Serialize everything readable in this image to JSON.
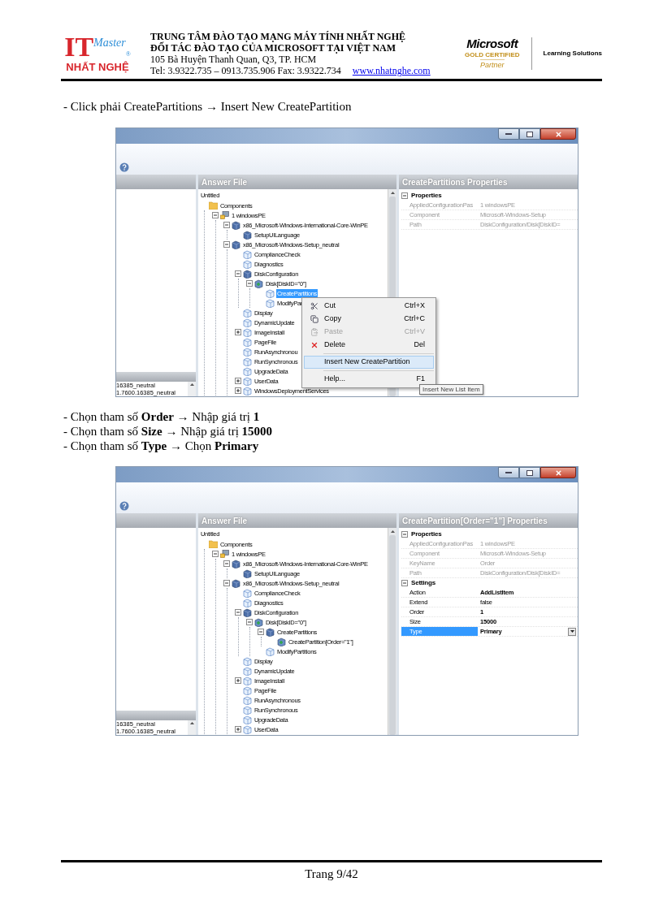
{
  "header": {
    "logo": {
      "mark": "IT",
      "script": "Master",
      "registered": "®",
      "name": "NHẤT NGHỆ"
    },
    "lines": [
      {
        "text": "TRUNG TÂM ĐÀO TẠO MẠNG MÁY TÍNH NHẤT NGHỆ",
        "emphasis": true
      },
      {
        "text": "ĐỐI TÁC ĐÀO TẠO CỦA MICROSOFT TẠI VIỆT NAM",
        "emphasis": true
      },
      {
        "text": "105 Bà Huyện Thanh Quan, Q3, TP. HCM",
        "emphasis": false
      },
      {
        "text": "Tel: 3.9322.735 – 0913.735.906 Fax: 3.9322.734",
        "emphasis": false
      }
    ],
    "website": "www.nhatnghe.com",
    "partner": {
      "brand": "Microsoft",
      "level": "GOLD CERTIFIED",
      "tier": "Partner",
      "tagline": "Learning Solutions"
    }
  },
  "sections": [
    {
      "instructions": [
        "- Click phải CreatePartitions → Insert New CreatePartition"
      ],
      "screenshot": {
        "left_pane": {
          "list": [
            "16385_neutral",
            "1.7600.16385_neutral"
          ]
        },
        "answer_file": {
          "title": "Answer File",
          "root_label": "Untitled",
          "tree": [
            {
              "label": "Components",
              "kind": "folder",
              "selected": false,
              "children": [
                {
                  "label": "1 windowsPE",
                  "kind": "pass",
                  "selected": false,
                  "expanded": true,
                  "children": [
                    {
                      "label": "x86_Microsoft-Windows-International-Core-WinPE",
                      "kind": "component",
                      "selected": false,
                      "expanded": true,
                      "children": [
                        {
                          "label": "SetupUILanguage",
                          "kind": "component",
                          "selected": false
                        }
                      ]
                    },
                    {
                      "label": "x86_Microsoft-Windows-Setup_neutral",
                      "kind": "component",
                      "selected": false,
                      "expanded": true,
                      "children": [
                        {
                          "label": "ComplianceCheck",
                          "kind": "setting",
                          "selected": false
                        },
                        {
                          "label": "Diagnostics",
                          "kind": "setting",
                          "selected": false
                        },
                        {
                          "label": "DiskConfiguration",
                          "kind": "component",
                          "selected": false,
                          "expanded": true,
                          "children": [
                            {
                              "label": "Disk[DiskID=\"0\"]",
                              "kind": "listitem",
                              "selected": false,
                              "expanded": true,
                              "children": [
                                {
                                  "label": "CreatePartitions",
                                  "kind": "setting",
                                  "selected": true
                                },
                                {
                                  "label": "ModifyPar",
                                  "kind": "setting",
                                  "selected": false
                                }
                              ]
                            }
                          ]
                        },
                        {
                          "label": "Display",
                          "kind": "setting",
                          "selected": false
                        },
                        {
                          "label": "DynamicUpdate",
                          "kind": "setting",
                          "selected": false
                        },
                        {
                          "label": "ImageInstall",
                          "kind": "setting",
                          "selected": false,
                          "expanded": false
                        },
                        {
                          "label": "PageFile",
                          "kind": "setting",
                          "selected": false
                        },
                        {
                          "label": "RunAsynchronou",
                          "kind": "setting",
                          "selected": false
                        },
                        {
                          "label": "RunSynchronous",
                          "kind": "setting",
                          "selected": false
                        },
                        {
                          "label": "UpgradeData",
                          "kind": "setting",
                          "selected": false
                        },
                        {
                          "label": "UserData",
                          "kind": "setting",
                          "selected": false,
                          "expanded": false
                        },
                        {
                          "label": "WindowsDeploymentServices",
                          "kind": "setting",
                          "selected": false,
                          "expanded": false
                        }
                      ]
                    }
                  ]
                }
              ]
            }
          ]
        },
        "properties": {
          "title": "CreatePartitions Properties",
          "sections": [
            {
              "label": "Properties",
              "expanded": true,
              "rows": [
                {
                  "name": "AppliedConfigurationPas",
                  "value": "1 windowsPE",
                  "readonly": true,
                  "modified": false,
                  "selected": false
                },
                {
                  "name": "Component",
                  "value": "Microsoft-Windows-Setup",
                  "readonly": true,
                  "modified": false,
                  "selected": false
                },
                {
                  "name": "Path",
                  "value": "DiskConfiguration/Disk[DiskID=",
                  "readonly": true,
                  "modified": false,
                  "selected": false
                }
              ]
            }
          ]
        },
        "context_menu": {
          "items": [
            {
              "kind": "item",
              "label": "Cut",
              "shortcut": "Ctrl+X",
              "disabled": false,
              "selected": false
            },
            {
              "kind": "item",
              "label": "Copy",
              "shortcut": "Ctrl+C",
              "disabled": false,
              "selected": false
            },
            {
              "kind": "item",
              "label": "Paste",
              "shortcut": "Ctrl+V",
              "disabled": true,
              "selected": false
            },
            {
              "kind": "item",
              "label": "Delete",
              "shortcut": "Del",
              "disabled": false,
              "selected": false
            },
            {
              "kind": "separator"
            },
            {
              "kind": "item",
              "label": "Insert New CreatePartition",
              "disabled": false,
              "selected": true
            },
            {
              "kind": "separator"
            },
            {
              "kind": "item",
              "label": "Help...",
              "shortcut": "F1",
              "disabled": false,
              "selected": false
            }
          ]
        },
        "tooltip": "Insert New List Item"
      }
    },
    {
      "instructions": [
        "- Chọn tham số **Order** → Nhập giá trị **1**",
        "- Chọn tham số **Size** → Nhập giá trị **15000**",
        "- Chọn tham số **Type** → Chọn **Primary**"
      ],
      "screenshot": {
        "left_pane": {
          "list": [
            "16385_neutral",
            "1.7600.16385_neutral"
          ]
        },
        "answer_file": {
          "title": "Answer File",
          "root_label": "Untitled",
          "tree": [
            {
              "label": "Components",
              "kind": "folder",
              "selected": false,
              "children": [
                {
                  "label": "1 windowsPE",
                  "kind": "pass",
                  "selected": false,
                  "expanded": true,
                  "children": [
                    {
                      "label": "x86_Microsoft-Windows-International-Core-WinPE",
                      "kind": "component",
                      "selected": false,
                      "expanded": true,
                      "children": [
                        {
                          "label": "SetupUILanguage",
                          "kind": "component",
                          "selected": false
                        }
                      ]
                    },
                    {
                      "label": "x86_Microsoft-Windows-Setup_neutral",
                      "kind": "component",
                      "selected": false,
                      "expanded": true,
                      "children": [
                        {
                          "label": "ComplianceCheck",
                          "kind": "setting",
                          "selected": false
                        },
                        {
                          "label": "Diagnostics",
                          "kind": "setting",
                          "selected": false
                        },
                        {
                          "label": "DiskConfiguration",
                          "kind": "component",
                          "selected": false,
                          "expanded": true,
                          "children": [
                            {
                              "label": "Disk[DiskID=\"0\"]",
                              "kind": "listitem",
                              "selected": false,
                              "expanded": true,
                              "children": [
                                {
                                  "label": "CreatePartitions",
                                  "kind": "component",
                                  "selected": false,
                                  "expanded": true,
                                  "children": [
                                    {
                                      "label": "CreatePartition[Order=\"1\"]",
                                      "kind": "listitem",
                                      "selected": false
                                    }
                                  ]
                                },
                                {
                                  "label": "ModifyPartitions",
                                  "kind": "setting",
                                  "selected": false
                                }
                              ]
                            }
                          ]
                        },
                        {
                          "label": "Display",
                          "kind": "setting",
                          "selected": false
                        },
                        {
                          "label": "DynamicUpdate",
                          "kind": "setting",
                          "selected": false
                        },
                        {
                          "label": "ImageInstall",
                          "kind": "setting",
                          "selected": false,
                          "expanded": false
                        },
                        {
                          "label": "PageFile",
                          "kind": "setting",
                          "selected": false
                        },
                        {
                          "label": "RunAsynchronous",
                          "kind": "setting",
                          "selected": false
                        },
                        {
                          "label": "RunSynchronous",
                          "kind": "setting",
                          "selected": false
                        },
                        {
                          "label": "UpgradeData",
                          "kind": "setting",
                          "selected": false
                        },
                        {
                          "label": "UserData",
                          "kind": "setting",
                          "selected": false,
                          "expanded": false
                        }
                      ]
                    }
                  ]
                }
              ]
            }
          ]
        },
        "properties": {
          "title": "CreatePartition[Order=\"1\"] Properties",
          "sections": [
            {
              "label": "Properties",
              "expanded": true,
              "rows": [
                {
                  "name": "AppliedConfigurationPas",
                  "value": "1 windowsPE",
                  "readonly": true,
                  "modified": false,
                  "selected": false
                },
                {
                  "name": "Component",
                  "value": "Microsoft-Windows-Setup",
                  "readonly": true,
                  "modified": false,
                  "selected": false
                },
                {
                  "name": "KeyName",
                  "value": "Order",
                  "readonly": true,
                  "modified": false,
                  "selected": false
                },
                {
                  "name": "Path",
                  "value": "DiskConfiguration/Disk[DiskID=",
                  "readonly": true,
                  "modified": false,
                  "selected": false
                }
              ]
            },
            {
              "label": "Settings",
              "expanded": true,
              "rows": [
                {
                  "name": "Action",
                  "value": "AddListItem",
                  "readonly": false,
                  "modified": true,
                  "selected": false
                },
                {
                  "name": "Extend",
                  "value": "false",
                  "readonly": false,
                  "modified": false,
                  "selected": false
                },
                {
                  "name": "Order",
                  "value": "1",
                  "readonly": false,
                  "modified": true,
                  "selected": false
                },
                {
                  "name": "Size",
                  "value": "15000",
                  "readonly": false,
                  "modified": true,
                  "selected": false
                },
                {
                  "name": "Type",
                  "value": "Primary",
                  "readonly": false,
                  "modified": true,
                  "selected": true
                }
              ]
            }
          ]
        }
      }
    }
  ],
  "footer": {
    "page": "Trang 9/42"
  }
}
